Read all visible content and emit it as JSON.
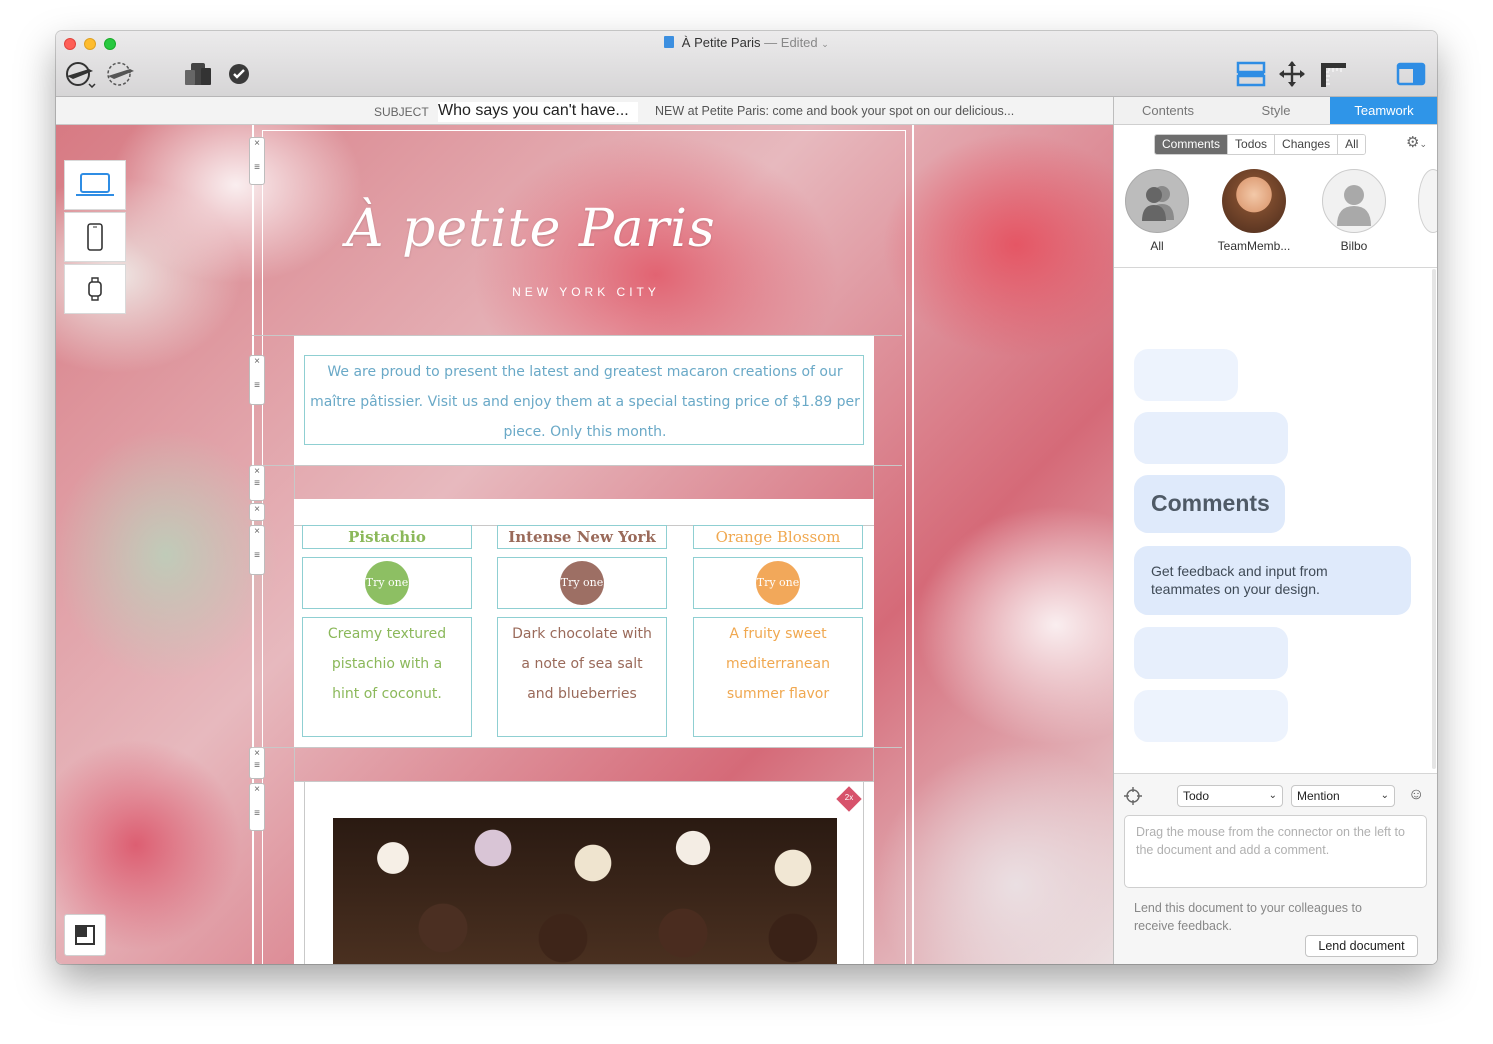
{
  "window": {
    "title": "À Petite Paris",
    "status": "— Edited",
    "traffic_colors": [
      "#fe5f57",
      "#febc2e",
      "#28c840"
    ]
  },
  "toolbar": {
    "left_icons": [
      "send-test-icon",
      "send-icon",
      "devices-preview-icon",
      "check-icon"
    ],
    "right_icons": [
      "layout-icon",
      "move-icon",
      "ruler-icon",
      "panel-toggle-icon"
    ]
  },
  "subject_bar": {
    "label": "SUBJECT",
    "subject": "Who says you can't have...",
    "preheader": "NEW at Petite Paris: come and book your spot on our delicious..."
  },
  "device_buttons": [
    "laptop-icon",
    "phone-icon",
    "watch-icon"
  ],
  "email": {
    "logo": "À petite Paris",
    "city": "NEW YORK CITY",
    "intro": "We are proud to present the latest and greatest macaron creations of our maître pâtissier. Visit us and enjoy them at a special tasting price of $1.89 per piece. Only this month.",
    "cards": [
      {
        "title": "Pistachio",
        "try": "Try one",
        "desc": "Creamy textured pistachio with a hint of coconut.",
        "color": "#8bb85a",
        "circle": "#8dbf63"
      },
      {
        "title": "Intense New York",
        "try": "Try one",
        "desc": "Dark chocolate with a note of sea salt and blueberries",
        "color": "#9a6a5a",
        "circle": "#9d6f64"
      },
      {
        "title": "Orange Blossom",
        "try": "Try one",
        "desc": "A fruity sweet mediterranean summer flavor",
        "color": "#f0a850",
        "circle": "#f2a85a"
      }
    ],
    "retina_badge": "2x"
  },
  "panel": {
    "tabs": [
      "Contents",
      "Style",
      "Teamwork"
    ],
    "active_tab": "Teamwork",
    "filters": [
      "Comments",
      "Todos",
      "Changes",
      "All"
    ],
    "active_filter": "Comments",
    "members": [
      "All",
      "TeamMemb...",
      "Bilbo"
    ],
    "heading": "Comments",
    "description": "Get feedback and input from teammates on your design.",
    "todo_select": "Todo",
    "mention_select": "Mention",
    "comment_placeholder": "Drag the mouse from the connector on the left to the document and add a comment.",
    "lend_text": "Lend this document to your colleagues to receive feedback.",
    "lend_button": "Lend document"
  }
}
